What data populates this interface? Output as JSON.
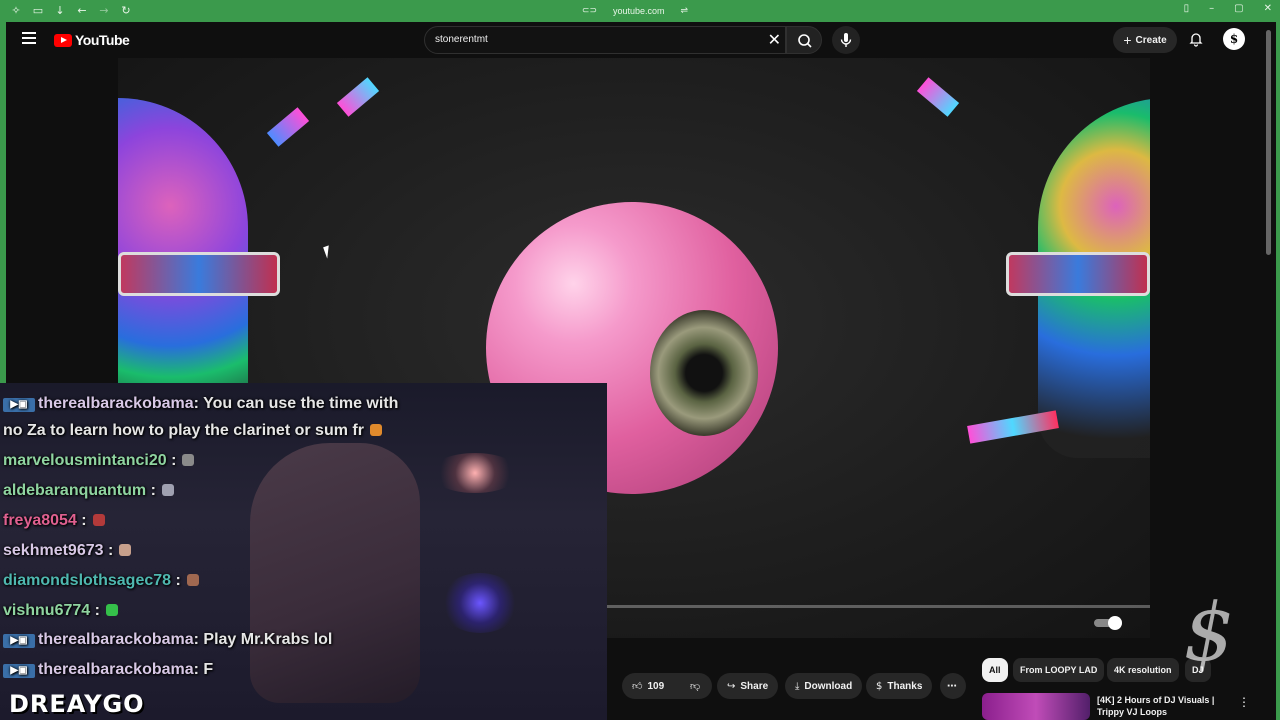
{
  "browser": {
    "url": "youtube.com",
    "icons": [
      "extensions-icon",
      "tabs-icon",
      "download-icon",
      "back-icon",
      "forward-icon",
      "reload-icon"
    ]
  },
  "youtube": {
    "logo_text": "YouTube",
    "search_value": "stonerentmt",
    "create_label": "Create",
    "avatar_letter": "$"
  },
  "video_actions": {
    "like_count": "109",
    "share_label": "Share",
    "download_label": "Download",
    "thanks_label": "Thanks"
  },
  "chips": [
    "All",
    "From LOOPY LAD",
    "4K resolution",
    "DJ"
  ],
  "recommendation": {
    "title": "[4K] 2 Hours of DJ Visuals | Trippy VJ Loops"
  },
  "chat": [
    {
      "badge": true,
      "user": "therealbarackobama",
      "text": ": You can use the time with",
      "user_color": "#d8c8e6"
    },
    {
      "badge": false,
      "user": "",
      "text": "no Za to learn how to play the clarinet or sum fr",
      "user_color": "#d8c8e6",
      "emote": "#e08a2c"
    },
    {
      "badge": false,
      "user": "marvelousmintanci20",
      "text": " :",
      "user_color": "#8fd4a0",
      "emote": "#8a8a8a"
    },
    {
      "badge": false,
      "user": "aldebaranquantum",
      "text": " :",
      "user_color": "#8fd4a0",
      "emote": "#9fa0b0"
    },
    {
      "badge": false,
      "user": "freya8054",
      "text": " :",
      "user_color": "#e06090",
      "emote": "#b33a3a"
    },
    {
      "badge": false,
      "user": "sekhmet9673",
      "text": " :",
      "user_color": "#d8c8e6",
      "emote": "#c7a08c"
    },
    {
      "badge": false,
      "user": "diamondslothsagec78",
      "text": " :",
      "user_color": "#4fb8b0",
      "emote": "#a06850"
    },
    {
      "badge": false,
      "user": "vishnu6774",
      "text": " :",
      "user_color": "#8fd4a0",
      "emote": "#35c04a"
    },
    {
      "badge": true,
      "user": "therealbarackobama",
      "text": ": Play Mr.Krabs lol",
      "user_color": "#d8c8e6"
    },
    {
      "badge": true,
      "user": "therealbarackobama",
      "text": ": F",
      "user_color": "#d8c8e6"
    }
  ],
  "streamer_name": "DREAYGO",
  "colors": {
    "browser_green": "#3b9a4c",
    "youtube_red": "#ff0000",
    "background": "#0f0f0f",
    "eyeball_pink": "#e0609f"
  }
}
